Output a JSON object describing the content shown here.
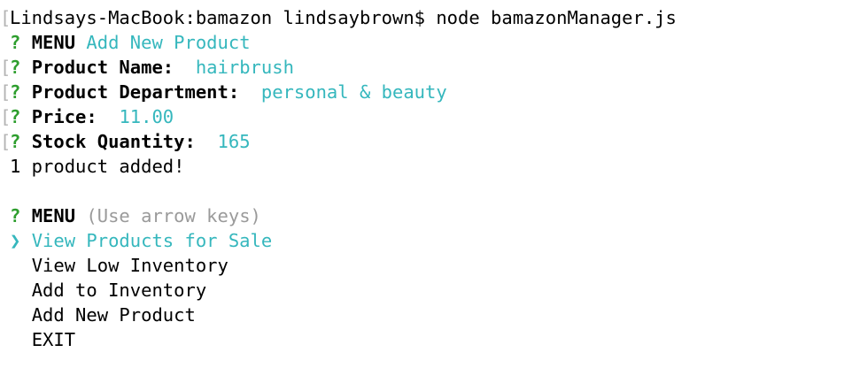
{
  "terminal": {
    "gutter_mark": "[",
    "command_line": "Lindsays-MacBook:bamazon lindsaybrown$ node bamazonManager.js",
    "question_mark": "?",
    "first_menu": {
      "label": "MENU",
      "answer": "Add New Product"
    },
    "prompts": [
      {
        "label": "Product Name:",
        "answer": "hairbrush"
      },
      {
        "label": "Product Department:",
        "answer": "personal & beauty"
      },
      {
        "label": "Price:",
        "answer": "11.00"
      },
      {
        "label": "Stock Quantity:",
        "answer": "165"
      }
    ],
    "result_message": "1 product added!",
    "second_menu": {
      "label": "MENU",
      "hint": "(Use arrow keys)",
      "pointer": "❯",
      "options": [
        "View Products for Sale",
        "View Low Inventory",
        "Add to Inventory",
        "Add New Product",
        "EXIT"
      ],
      "selected_index": 0
    }
  }
}
